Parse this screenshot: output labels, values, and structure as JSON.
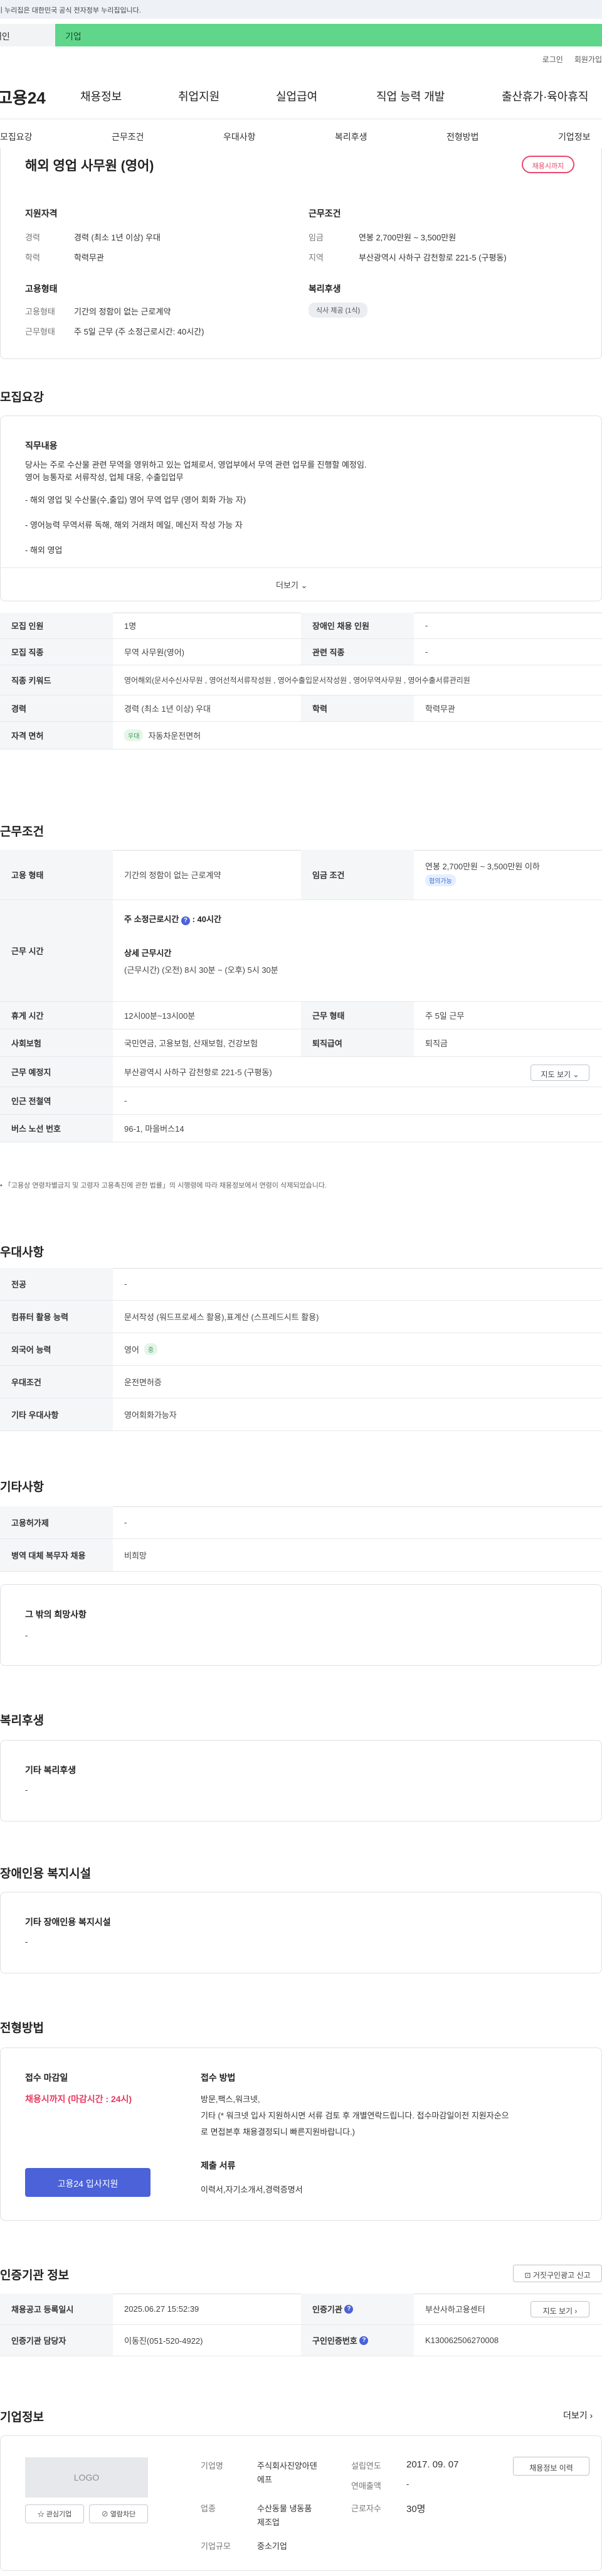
{
  "gov_banner": "이 누리집은 대한민국 공식 전자정부 누리집입니다.",
  "member_tabs": {
    "person": "개인",
    "company": "기업"
  },
  "util_nav": [
    "로그인",
    "회원가입"
  ],
  "header": {
    "logo": "고용24",
    "gnb": [
      "채용정보",
      "취업지원",
      "실업급여",
      "직업 능력 개발",
      "출산휴가·육아휴직"
    ]
  },
  "subnav": [
    "모집요강",
    "근무조건",
    "우대사항",
    "복리후생",
    "전형방법",
    "기업정보"
  ],
  "summary": {
    "title": "해외 영업 사무원 (영어)",
    "status_pill": "채용시까지",
    "qual_heading": "지원자격",
    "career_label": "경력",
    "career_value": "경력 (최소 1년 이상) 우대",
    "edu_label": "학력",
    "edu_value": "학력무관",
    "cond_heading": "근무조건",
    "pay_label": "임금",
    "pay_value": "연봉 2,700만원 ~ 3,500만원",
    "region_label": "지역",
    "region_value": "부산광역시 사하구 감천항로 221-5 (구평동)",
    "emp_heading": "고용형태",
    "emp_label": "고용형태",
    "emp_value": "기간의 정함이 없는 근로계약",
    "work_label": "근무형태",
    "work_value": "주 5일 근무 (주 소정근로시간: 40시간)",
    "welfare_heading": "복리후생",
    "welfare_chip": "식사 제공 (1식)"
  },
  "recruit": {
    "title": "모집요강",
    "duty_heading": "직무내용",
    "duty_lines": [
      "당사는 주로 수산물 관련 무역을 영위하고 있는 업체로서, 영업부에서 무역 관련 업무를 진행할 예정임.",
      "영어 능통자로 서류작성, 업체 대응, 수출입업무",
      "- 해외 영업 및 수산물(수,출입) 영어 무역 업무 (영어 회화 가능 자)",
      "- 영어능력 무역서류 독해, 해외 거래처 메일, 메신저 작성 가능 자",
      "- 해외 영업"
    ],
    "more": "더보기",
    "rows": [
      {
        "k1": "모집 인원",
        "v1": "1명",
        "k2": "장애인 채용 인원",
        "v2": "-"
      },
      {
        "k1": "모집 직종",
        "v1": "무역 사무원(영어)",
        "k2": "관련 직종",
        "v2": "-"
      },
      {
        "k1": "직종 키워드",
        "v1": "영어해외(문서수신사무원 , 영어선적서류작성원 , 영어수출입문서작성원 , 영어무역사무원 , 영어수출서류관리원"
      },
      {
        "k1": "경력",
        "v1": "경력 (최소 1년 이상) 우대",
        "k2": "학력",
        "v2": "학력무관"
      },
      {
        "k1": "자격 면허",
        "badge": "우대",
        "v1": "자동차운전면허"
      }
    ]
  },
  "conditions": {
    "title": "근무조건",
    "emp_type_label": "고용 형태",
    "emp_type_value": "기간의 정함이 없는 근로계약",
    "wage_label": "임금 조건",
    "wage_value": "연봉 2,700만원 ~ 3,500만원 이하",
    "wage_badge": "협의가능",
    "hours_label": "근무 시간",
    "hours_main": "주 소정근로시간",
    "hours_main_val": ": 40시간",
    "hours_detail_label": "상세 근무시간",
    "hours_detail_val": "(근무시간) (오전) 8시 30분 ~ (오후) 5시 30분",
    "break_label": "휴게 시간",
    "break_value": "12시00분~13시00분",
    "shift_label": "근무 형태",
    "shift_value": "주 5일 근무",
    "insurance_label": "사회보험",
    "insurance_value": "국민연금, 고용보험, 산재보험, 건강보험",
    "severance_label": "퇴직급여",
    "severance_value": "퇴직금",
    "place_label": "근무 예정지",
    "place_value": "부산광역시 사하구 감천항로 221-5 (구평동)",
    "map_btn": "지도 보기",
    "station_label": "인근 전철역",
    "station_value": "-",
    "bus_label": "버스 노선 번호",
    "bus_value": "96-1, 마을버스14",
    "footnote": "「고용상 연령차별금지 및 고령자 고용촉진에 관한 법률」의 시행령에 따라 채용정보에서 연령이 삭제되었습니다."
  },
  "prefer": {
    "title": "우대사항",
    "rows": [
      {
        "k": "전공",
        "v": "-"
      },
      {
        "k": "컴퓨터 활용 능력",
        "v": "문서작성 (워드프로세스 활용),표계산 (스프레드시트 활용)"
      },
      {
        "k": "외국어 능력",
        "v": "영어",
        "badge": "중"
      },
      {
        "k": "우대조건",
        "v": "운전면허증"
      },
      {
        "k": "기타 우대사항",
        "v": "영어회화가능자"
      }
    ]
  },
  "etc": {
    "title": "기타사항",
    "rows": [
      {
        "k": "고용허가제",
        "v": "-"
      },
      {
        "k": "병역 대체 복무자 채용",
        "v": "비희망"
      }
    ],
    "other_heading": "그 밖의 희망사항",
    "other_value": "-"
  },
  "welfare": {
    "title": "복리후생",
    "heading": "기타 복리후생",
    "value": "-"
  },
  "disability": {
    "title": "장애인용 복지시설",
    "heading": "기타 장애인용 복지시설",
    "value": "-"
  },
  "selection": {
    "title": "전형방법",
    "deadline_label": "접수 마감일",
    "deadline_value": "채용시까지 (마감시간 : 24시)",
    "apply_btn": "고용24 입사지원",
    "method_label": "접수 방법",
    "method_lines": [
      "방문,팩스,워크넷,",
      "기타 (* 워크넷 입사 지원하시면 서류 검토 후 개별연락드립니다. 접수마감일이전 지원자순으",
      "로 면접본후 채용결정되니 빠른지원바랍니다.)"
    ],
    "docs_label": "제출 서류",
    "docs_value": "이력서,자기소개서,경력증명서"
  },
  "cert": {
    "title": "인증기관 정보",
    "report_btn": "거짓구인광고 신고",
    "reg_label": "채용공고 등록일시",
    "reg_value": "2025.06.27 15:52:39",
    "agency_label": "인증기관",
    "agency_value": "부산사하고용센터",
    "map_btn": "지도 보기",
    "officer_label": "인증기관 담당자",
    "officer_value": "이동진(051-520-4922)",
    "cert_no_label": "구인인증번호",
    "cert_no_value": "K130062506270008"
  },
  "company": {
    "title": "기업정보",
    "more": "더보기",
    "logo": "LOGO",
    "interest_btn": "관심기업",
    "block_btn": "열람차단",
    "f_name_label": "기업명",
    "f_name_value_1": "주식회사진양아덴",
    "f_name_value_2": "에프",
    "f_industry_label": "업종",
    "f_industry_value_1": "수산동물 냉동품",
    "f_industry_value_2": "제조업",
    "f_size_label": "기업규모",
    "f_size_value": "중소기업",
    "f_founded_label": "설립연도",
    "f_founded_value": "2017. 09. 07",
    "f_revenue_label": "연매출액",
    "f_revenue_value": "-",
    "f_emp_label": "근로자수",
    "f_emp_value": "30명",
    "jobs_btn": "채용정보 이력"
  }
}
